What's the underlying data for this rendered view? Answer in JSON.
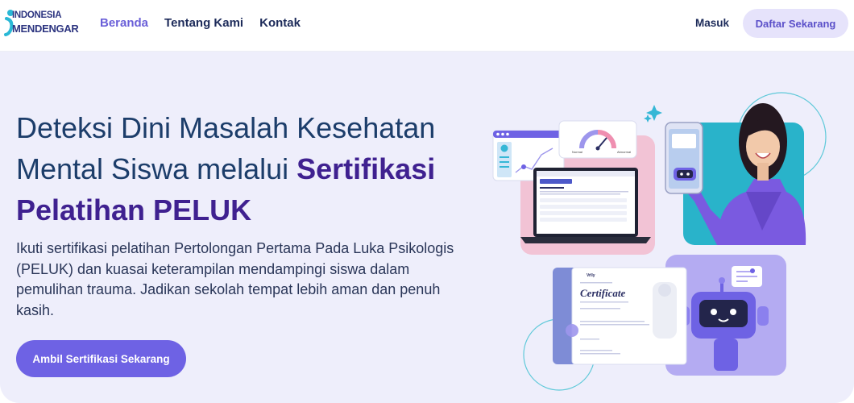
{
  "nav": {
    "logo_line1": "INDONESIA",
    "logo_line2": "MENDENGAR",
    "links": [
      {
        "label": "Beranda",
        "active": true
      },
      {
        "label": "Tentang Kami",
        "active": false
      },
      {
        "label": "Kontak",
        "active": false
      }
    ],
    "login_label": "Masuk",
    "register_label": "Daftar Sekarang"
  },
  "hero": {
    "headline_regular": "Deteksi Dini Masalah Kesehatan Mental Siswa melalui ",
    "headline_bold": "Sertifikasi Pelatihan PELUK",
    "description": "Ikuti sertifikasi pelatihan Pertolongan Pertama Pada Luka Psikologis (PELUK) dan kuasai keterampilan mendampingi siswa dalam pemulihan trauma. Jadikan sekolah tempat lebih aman dan penuh kasih.",
    "cta_label": "Ambil Sertifikasi Sekarang"
  },
  "illustration": {
    "certificate_title": "Certificate",
    "certificate_logo": "Vrlly",
    "gauge_left_label": "Normal",
    "gauge_right_label": "Abnormal"
  },
  "colors": {
    "brand_purple": "#6e62e4",
    "headline_blue": "#1c3d6a",
    "headline_purple": "#3f2190",
    "hero_bg": "#eeeefb"
  }
}
